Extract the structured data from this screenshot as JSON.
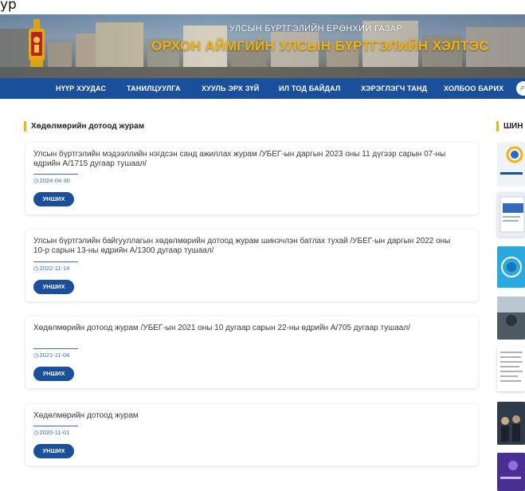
{
  "top_strip": {
    "text": "ур"
  },
  "banner": {
    "subtitle": "УЛСЫН БҮРТГЭЛИЙН ЕРӨНХИЙ ГАЗАР",
    "title": "ОРХОН АЙМГИЙН УЛСЫН БҮРТГЭЛИЙН ХЭЛТЭС"
  },
  "nav": {
    "items": [
      {
        "label": "НҮҮР ХУУДАС"
      },
      {
        "label": "ТАНИЛЦУУЛГА"
      },
      {
        "label": "ХУУЛЬ ЭРХ ЗҮЙ"
      },
      {
        "label": "ИЛ ТОД БАЙДАЛ"
      },
      {
        "label": "ХЭРЭГЛЭГЧ ТАНД"
      },
      {
        "label": "ХОЛБОО БАРИХ"
      }
    ]
  },
  "main": {
    "section_title": "Хөдөлмөрийн дотоод журам",
    "button_label": "УНШИХ",
    "posts": [
      {
        "title": "Улсын бүртгэлийн мэдээллийн нэгдсэн санд ажиллах журам /УБЕГ-ын даргын 2023 оны 11 дүгээр сарын 07-ны өдрийн А/1715 дугаар тушаал/",
        "date": "2024-04-30"
      },
      {
        "title": "Улсын бүртгэлийн байгууллагын хөдөлмөрийн дотоод журам шинэчлэн батлах тухай /УБЕГ-ын даргын 2022 оны 10-р сарын 13-ны өдрийн А/1300 дугаар тушаал/",
        "date": "2022-11-14"
      },
      {
        "title": "Хөдөлмөрийн дотоод журам /УБЕГ-ын 2021 оны 10 дугаар сарын 22-ны өдрийн А/705 дугаар тушаал/",
        "date": "2021-11-04"
      },
      {
        "title": "Хөдөлмөрийн дотоод журам",
        "date": "2020-11-01"
      }
    ]
  },
  "sidebar": {
    "title": "ШИН"
  },
  "colors": {
    "nav_bg": "#1a4f9c",
    "accent_gold": "#f5b400",
    "banner_title": "#f1b20b",
    "link_blue": "#3b6cc0"
  }
}
